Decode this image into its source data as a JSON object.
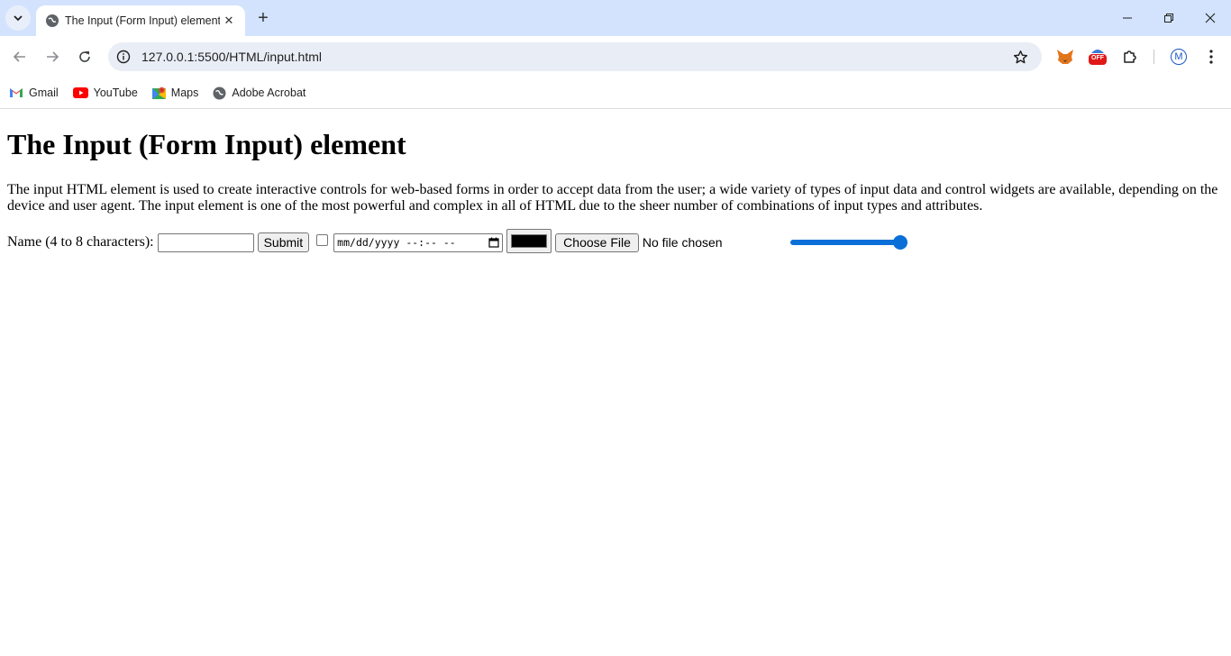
{
  "browser": {
    "tab_title": "The Input (Form Input) element",
    "url": "127.0.0.1:5500/HTML/input.html",
    "bookmarks": [
      {
        "label": "Gmail",
        "icon": "gmail-icon"
      },
      {
        "label": "YouTube",
        "icon": "youtube-icon"
      },
      {
        "label": "Maps",
        "icon": "maps-icon"
      },
      {
        "label": "Adobe Acrobat",
        "icon": "globe-icon"
      }
    ],
    "extension_badge": "OFF",
    "profile_initial": "M"
  },
  "page": {
    "heading": "The Input (Form Input) element",
    "description": "The input HTML element is used to create interactive controls for web-based forms in order to accept data from the user; a wide variety of types of input data and control widgets are available, depending on the device and user agent. The input element is one of the most powerful and complex in all of HTML due to the sheer number of combinations of input types and attributes.",
    "form": {
      "name_label": "Name (4 to 8 characters):",
      "name_value": "",
      "submit_label": "Submit",
      "checkbox_checked": false,
      "datetime_placeholder": "mm/dd/yyyy --:-- --",
      "color_value": "#000000",
      "file_button_label": "Choose File",
      "file_status": "No file chosen",
      "range_value_percent": 100,
      "range_color": "#0b6fd8"
    }
  }
}
